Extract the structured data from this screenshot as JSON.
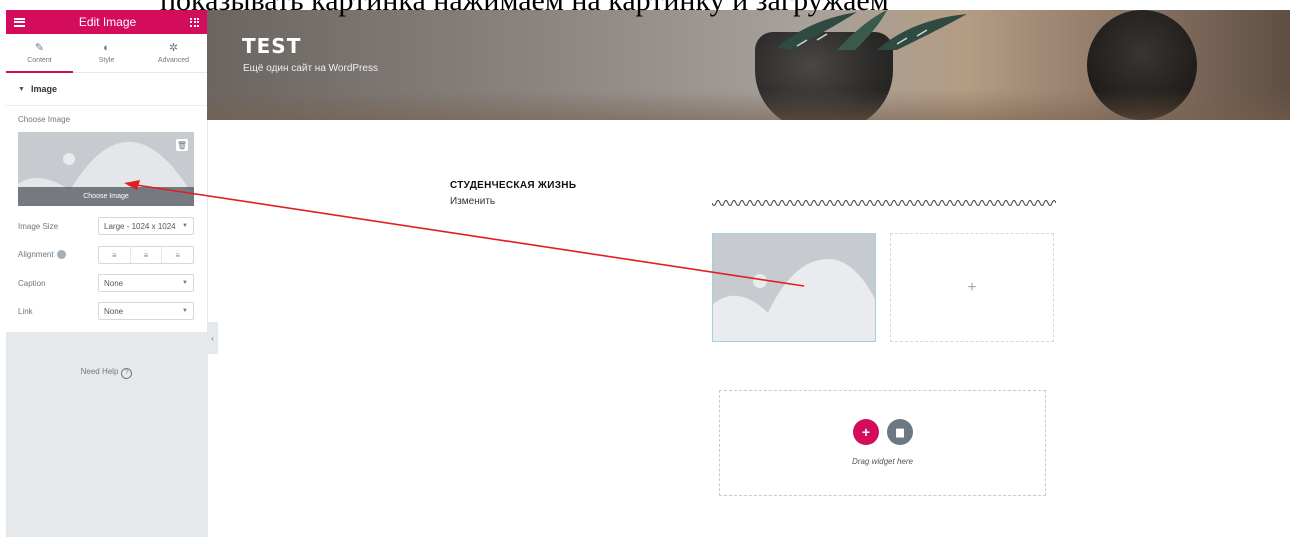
{
  "top_caption": "показывать картинка нажимаем на картинку и загружаем",
  "editor": {
    "header_title": "Edit Image",
    "tabs": [
      {
        "label": "Content",
        "icon": "pencil-icon"
      },
      {
        "label": "Style",
        "icon": "contrast-icon"
      },
      {
        "label": "Advanced",
        "icon": "gear-icon"
      }
    ],
    "section_title": "Image",
    "choose_image_label": "Choose Image",
    "choose_image_overlay": "Choose Image",
    "image_size": {
      "label": "Image Size",
      "value": "Large - 1024 x 1024"
    },
    "alignment": {
      "label": "Alignment",
      "options": [
        "left",
        "center",
        "right"
      ]
    },
    "caption": {
      "label": "Caption",
      "value": "None"
    },
    "link": {
      "label": "Link",
      "value": "None"
    },
    "need_help": "Need Help",
    "collapse_glyph": "‹"
  },
  "site": {
    "title": "TEST",
    "tagline": "Ещё один сайт на WordPress"
  },
  "content": {
    "section_title": "СТУДЕНЧЕСКАЯ ЖИЗНЬ",
    "edit_link": "Изменить",
    "add_column_glyph": "+",
    "drag_widget_text": "Drag widget here"
  },
  "colors": {
    "accent": "#d30c5c",
    "panel_grey": "#e6e9ec",
    "placeholder_grey": "#c7cbd0",
    "annotation_arrow": "#e02020"
  }
}
